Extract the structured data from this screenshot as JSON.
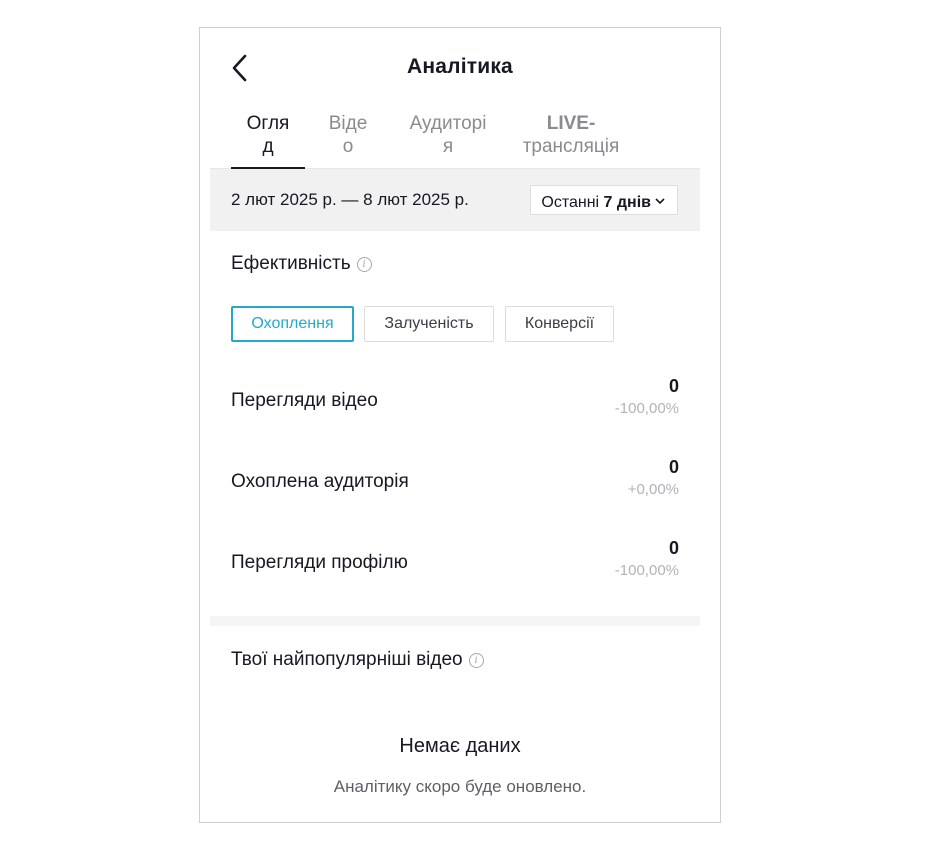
{
  "header": {
    "title": "Аналітика",
    "back_icon": "chevron-left-icon"
  },
  "tabs": [
    {
      "line1": "Огля",
      "line2": "д",
      "active": true
    },
    {
      "line1": "Віде",
      "line2": "о",
      "active": false
    },
    {
      "line1": "Аудиторі",
      "line2": "я",
      "active": false
    },
    {
      "line1": "LIVE-",
      "line2": "трансляція",
      "active": false
    }
  ],
  "date_filter": {
    "range": "2 лют 2025 р. — 8 лют 2025 р.",
    "period_prefix": "Останні ",
    "period_bold": "7 днів",
    "chevron_icon": "chevron-down-icon"
  },
  "performance": {
    "title": "Ефективність",
    "info_icon": "info-icon",
    "chips": [
      {
        "label": "Охоплення",
        "active": true
      },
      {
        "label": "Залученість",
        "active": false
      },
      {
        "label": "Конверсії",
        "active": false
      }
    ],
    "metrics": [
      {
        "label": "Перегляди відео",
        "value": "0",
        "delta": "-100,00%"
      },
      {
        "label": "Охоплена аудиторія",
        "value": "0",
        "delta": "+0,00%"
      },
      {
        "label": "Перегляди профілю",
        "value": "0",
        "delta": "-100,00%"
      }
    ]
  },
  "top_videos": {
    "title": "Твої найпопулярніші відео",
    "info_icon": "info-icon",
    "empty_title": "Немає даних",
    "empty_subtitle": "Аналітику скоро буде оновлено."
  },
  "colors": {
    "accent": "#25a9c8",
    "text": "#161823",
    "muted": "#8a8b91",
    "band": "#f1f1f2"
  }
}
